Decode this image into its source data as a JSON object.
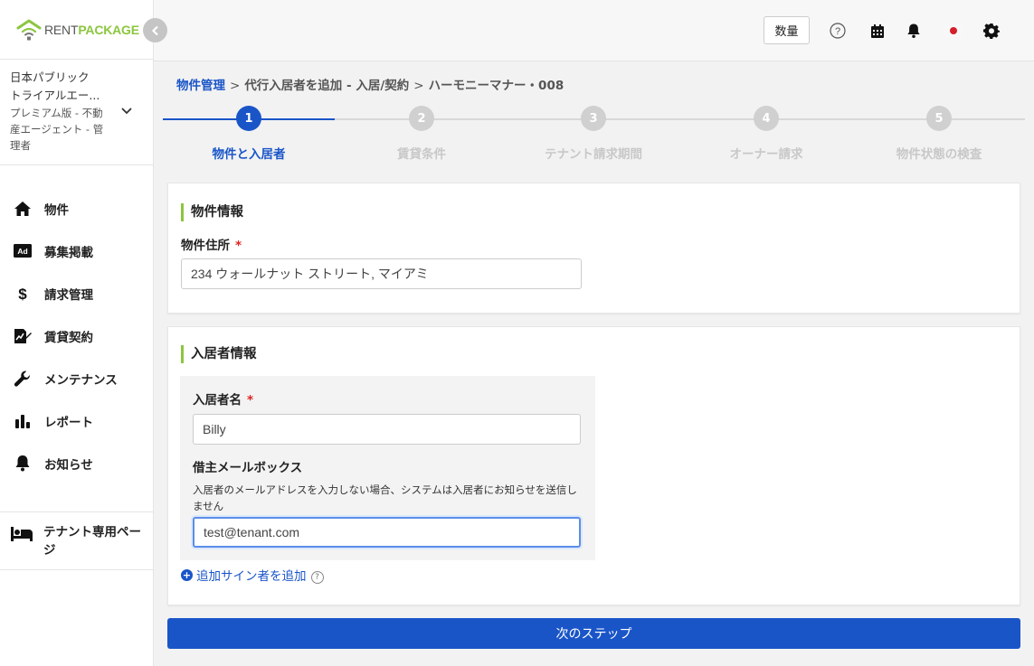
{
  "logo": {
    "rent": "RENT",
    "package": "PACKAGE"
  },
  "account": {
    "company": "日本パブリック",
    "trial": "トライアルエー...",
    "plan": "プレミアム版 - 不動産エージェント - 管理者"
  },
  "sidebar": {
    "items": [
      {
        "label": "物件",
        "icon": "home-icon"
      },
      {
        "label": "募集掲載",
        "icon": "ad-icon"
      },
      {
        "label": "請求管理",
        "icon": "dollar-icon"
      },
      {
        "label": "賃貸契約",
        "icon": "contract-icon"
      },
      {
        "label": "メンテナンス",
        "icon": "wrench-icon"
      },
      {
        "label": "レポート",
        "icon": "bar-chart-icon"
      },
      {
        "label": "お知らせ",
        "icon": "bell-icon"
      }
    ],
    "tenant_page": "テナント専用ページ"
  },
  "topbar": {
    "qty_label": "数量"
  },
  "breadcrumb": {
    "root": "物件管理",
    "middle": "代行入居者を追加 - 入居/契約",
    "current": "ハーモニーマナー・008",
    "sep": ">"
  },
  "stepper": {
    "steps": [
      {
        "num": "1",
        "label": "物件と入居者"
      },
      {
        "num": "2",
        "label": "賃貸条件"
      },
      {
        "num": "3",
        "label": "テナント請求期間"
      },
      {
        "num": "4",
        "label": "オーナー請求"
      },
      {
        "num": "5",
        "label": "物件状態の検査"
      }
    ],
    "active_step": 1
  },
  "property": {
    "title": "物件情報",
    "address_label": "物件住所",
    "required_mark": "*",
    "address_value": "234 ウォールナット ストリート, マイアミ"
  },
  "tenant": {
    "title": "入居者情報",
    "name_label": "入居者名",
    "name_value": "Billy",
    "email_label": "借主メールボックス",
    "email_hint": "入居者のメールアドレスを入力しない場合、システムは入居者にお知らせを送信しません",
    "email_value": "test@tenant.com",
    "add_signer": "追加サイン者を追加",
    "help": "?"
  },
  "next_button": "次のステップ",
  "colors": {
    "primary": "#1a55c8",
    "brand_green": "#8cc63f",
    "required": "#e02020"
  }
}
